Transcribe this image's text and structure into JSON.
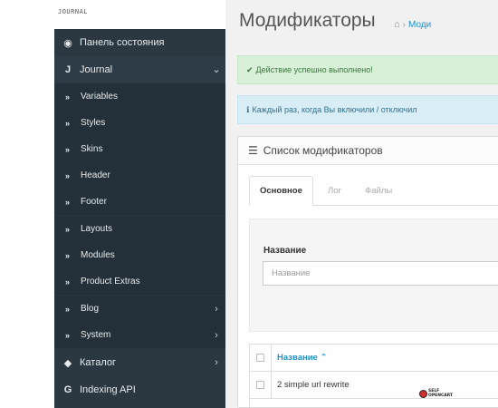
{
  "logo": {
    "text": "JOURNAL"
  },
  "sidebar": {
    "items": [
      {
        "icon": "dashboard-icon",
        "glyph": "◉",
        "label": "Панель состояния",
        "has_chevron": false
      },
      {
        "icon": "journal-icon",
        "glyph": "J",
        "label": "Journal",
        "has_chevron": true,
        "chevron": "⌄",
        "expanded": true
      },
      {
        "label": "Variables"
      },
      {
        "label": "Styles"
      },
      {
        "label": "Skins"
      },
      {
        "label": "Header"
      },
      {
        "label": "Footer"
      },
      {
        "label": "Layouts"
      },
      {
        "label": "Modules"
      },
      {
        "label": "Product Extras"
      },
      {
        "label": "Blog",
        "chevron": "›"
      },
      {
        "label": "System",
        "chevron": "›"
      },
      {
        "icon": "tag-icon",
        "glyph": "◆",
        "label": "Каталог",
        "chevron": "›"
      },
      {
        "icon": "google-icon",
        "glyph": "G",
        "label": "Indexing API"
      }
    ],
    "sub_marker": "»"
  },
  "header": {
    "title": "Модификаторы",
    "breadcrumb": {
      "home_glyph": "⌂",
      "separator": "›",
      "current": "Моди"
    }
  },
  "alerts": {
    "success": {
      "glyph": "✔",
      "text": "Действие успешно выполнено!"
    },
    "info": {
      "glyph": "ℹ",
      "text": "Каждый раз, когда Вы включили / отключил"
    }
  },
  "panel": {
    "glyph": "☰",
    "title": "Список модификаторов",
    "tabs": [
      {
        "label": "Основное",
        "active": true
      },
      {
        "label": "Лог",
        "active": false
      },
      {
        "label": "Файлы",
        "active": false
      }
    ],
    "filter": {
      "label": "Название",
      "placeholder": "Название",
      "value": ""
    },
    "table": {
      "columns": [
        {
          "label": "Название",
          "sort": "▲"
        }
      ],
      "sort_glyph": "⌃",
      "rows": [
        {
          "name": "2 simple url rewrite"
        }
      ]
    }
  },
  "watermark": {
    "line1": "SELF",
    "line2": "OPENCART"
  },
  "colors": {
    "sidebar_bg": "#2b3842",
    "link_blue": "#1e91cf",
    "success_bg": "#d7f0d7",
    "info_bg": "#d9edf7"
  }
}
